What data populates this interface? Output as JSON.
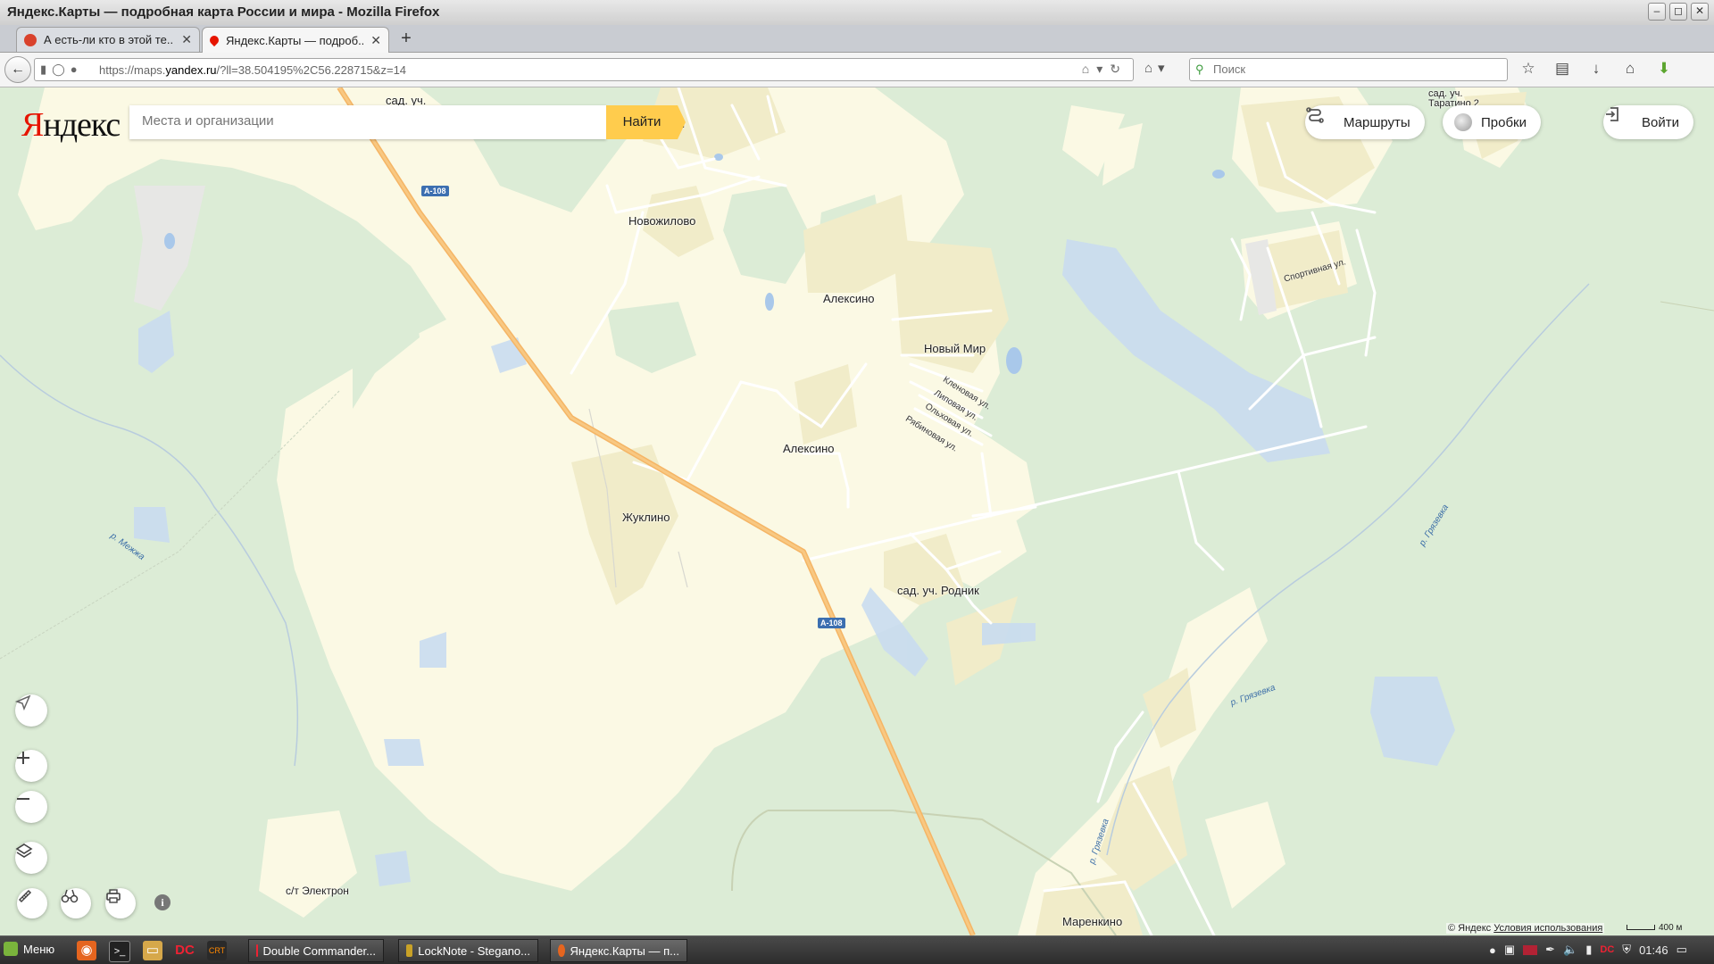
{
  "window": {
    "title": "Яндекс.Карты — подробная карта России и мира - Mozilla Firefox",
    "controls": [
      "–",
      "◻",
      "✕"
    ]
  },
  "tabs": [
    {
      "label": "А есть-ли кто в этой те...",
      "active": false,
      "close": "✕"
    },
    {
      "label": "Яндекс.Карты — подроб...",
      "active": true,
      "close": "✕"
    }
  ],
  "new_tab": "+",
  "navbar": {
    "url_prefix": "https://maps.",
    "url_domain": "yandex.ru",
    "url_rest": "/?ll=38.504195%2C56.228715&z=14",
    "search_placeholder": "Поиск"
  },
  "map": {
    "logo_first": "Я",
    "logo_rest": "ндекс",
    "search_placeholder": "Места и организации",
    "find_button": "Найти",
    "routes_button": "Маршруты",
    "traffic_button": "Пробки",
    "login_button": "Войти",
    "places": [
      {
        "id": "sad-uch-top",
        "text": "сад. уч."
      },
      {
        "id": "novozhilovo",
        "text": "Новожилово"
      },
      {
        "id": "aleksino-1",
        "text": "Алексино"
      },
      {
        "id": "novy-mir",
        "text": "Новый Мир"
      },
      {
        "id": "aleksino-2",
        "text": "Алексино"
      },
      {
        "id": "zhuklino",
        "text": "Жуклино"
      },
      {
        "id": "sad-uch-rodnik",
        "text": "сад. уч. Родник"
      },
      {
        "id": "st-elektron",
        "text": "с/т Электрон"
      },
      {
        "id": "marenkino",
        "text": "Маренкино"
      },
      {
        "id": "sad-uch-taratino",
        "text": "сад. уч. Таратино 2"
      },
      {
        "id": "partial-ya",
        "text": "я"
      }
    ],
    "streets": [
      {
        "id": "klenovaya",
        "text": "Кленовая ул."
      },
      {
        "id": "lipovaya",
        "text": "Липовая ул."
      },
      {
        "id": "olkhovaya",
        "text": "Ольховая ул."
      },
      {
        "id": "ryabinovaya",
        "text": "Рябиновая ул."
      },
      {
        "id": "sportivnaya",
        "text": "Спортивная ул."
      }
    ],
    "rivers": [
      {
        "id": "mezhzha",
        "text": "р. Межжа"
      },
      {
        "id": "gryazevka-1",
        "text": "р. Грязевка"
      },
      {
        "id": "gryazevka-2",
        "text": "р. Грязевка"
      },
      {
        "id": "gryazevka-3",
        "text": "р. Грязевка"
      }
    ],
    "road_shields": [
      "А-108",
      "А-108"
    ],
    "copyright": "© Яндекс",
    "terms": "Условия использования",
    "scale_label": "400 м",
    "info_glyph": "i"
  },
  "taskbar": {
    "menu_label": "Меню",
    "tasks": [
      {
        "label": "Double Commander...",
        "active": false
      },
      {
        "label": "LockNote - Stegano...",
        "active": false
      },
      {
        "label": "Яндекс.Карты — п...",
        "active": true
      }
    ],
    "clock": "01:46"
  },
  "colors": {
    "settlement": "#fbf9e4",
    "forest": "#dcecd6",
    "village_fill": "#f1ecc9",
    "federal_road": "#f5b565",
    "yandex_red": "#e61400",
    "find_button": "#ffcc4d",
    "water": "#a9c8ea"
  }
}
